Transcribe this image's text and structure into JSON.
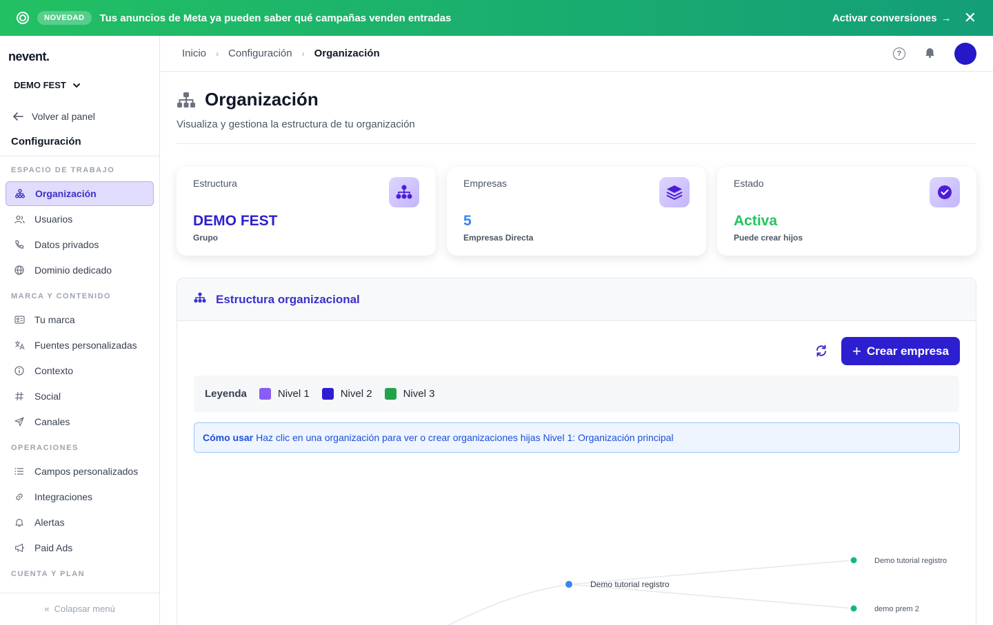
{
  "banner": {
    "badge": "NOVEDAD",
    "message": "Tus anuncios de Meta ya pueden saber qué campañas venden entradas",
    "cta": "Activar conversiones",
    "cta_arrow": "→",
    "close": "✕",
    "bg_color": "#1bb06d"
  },
  "sidebar": {
    "logo": "nevent.",
    "org_name": "DEMO FEST",
    "back_label": "Volver al panel",
    "config_title": "Configuración",
    "sections": {
      "workspace": "ESPACIO DE TRABAJO",
      "brand": "MARCA Y CONTENIDO",
      "operations": "OPERACIONES",
      "account": "CUENTA Y PLAN"
    },
    "items": {
      "organizacion": "Organización",
      "usuarios": "Usuarios",
      "datos_privados": "Datos privados",
      "dominio": "Dominio dedicado",
      "marca": "Tu marca",
      "fuentes": "Fuentes personalizadas",
      "contexto": "Contexto",
      "social": "Social",
      "canales": "Canales",
      "campos": "Campos personalizados",
      "integraciones": "Integraciones",
      "alertas": "Alertas",
      "paid_ads": "Paid Ads"
    },
    "collapse": "Colapsar menú"
  },
  "header": {
    "breadcrumb": [
      "Inicio",
      "Configuración",
      "Organización"
    ],
    "help": "?",
    "avatar_color": "#2418c9"
  },
  "page": {
    "title": "Organización",
    "subtitle": "Visualiza y gestiona la estructura de tu organización"
  },
  "cards": [
    {
      "label": "Estructura",
      "value": "DEMO FEST",
      "sub": "Grupo",
      "value_color": "#2d1fd0"
    },
    {
      "label": "Empresas",
      "value": "5",
      "sub": "Empresas Directa",
      "value_color": "#3b82f6"
    },
    {
      "label": "Estado",
      "value": "Activa",
      "sub": "Puede crear hijos",
      "value_color": "#22c55e"
    }
  ],
  "panel": {
    "title": "Estructura organizacional",
    "create_button": "Crear empresa",
    "legend_title": "Leyenda",
    "legend": [
      {
        "label": "Nivel 1",
        "color": "#8b5cf6"
      },
      {
        "label": "Nivel 2",
        "color": "#2d1fd0"
      },
      {
        "label": "Nivel 3",
        "color": "#22a34a"
      }
    ],
    "howto_bold": "Cómo usar",
    "howto_text": "Haz clic en una organización para ver o crear organizaciones hijas Nivel 1: Organización principal"
  },
  "tree": {
    "nodes": [
      {
        "label": "Demo tutorial registro",
        "level": 2,
        "color": "#3b82f6"
      },
      {
        "label": "Demo tutorial registro",
        "level": 3,
        "color": "#10b981"
      },
      {
        "label": "demo prem 2",
        "level": 3,
        "color": "#10b981"
      }
    ]
  }
}
